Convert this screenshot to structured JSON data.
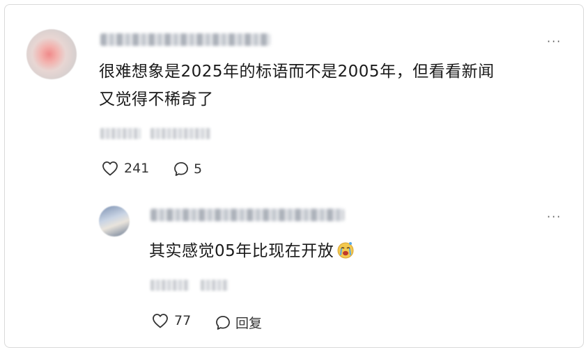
{
  "comment": {
    "text_line1": "很难想象是2025年的标语而不是2005年，但看看新闻",
    "text_line2": "又觉得不稀奇了",
    "like_count": "241",
    "reply_count": "5",
    "more_label": "···"
  },
  "reply": {
    "text": "其实感觉05年比现在开放",
    "emoji": "crying-face-emoji",
    "like_count": "77",
    "reply_label": "回复",
    "more_label": "···"
  }
}
